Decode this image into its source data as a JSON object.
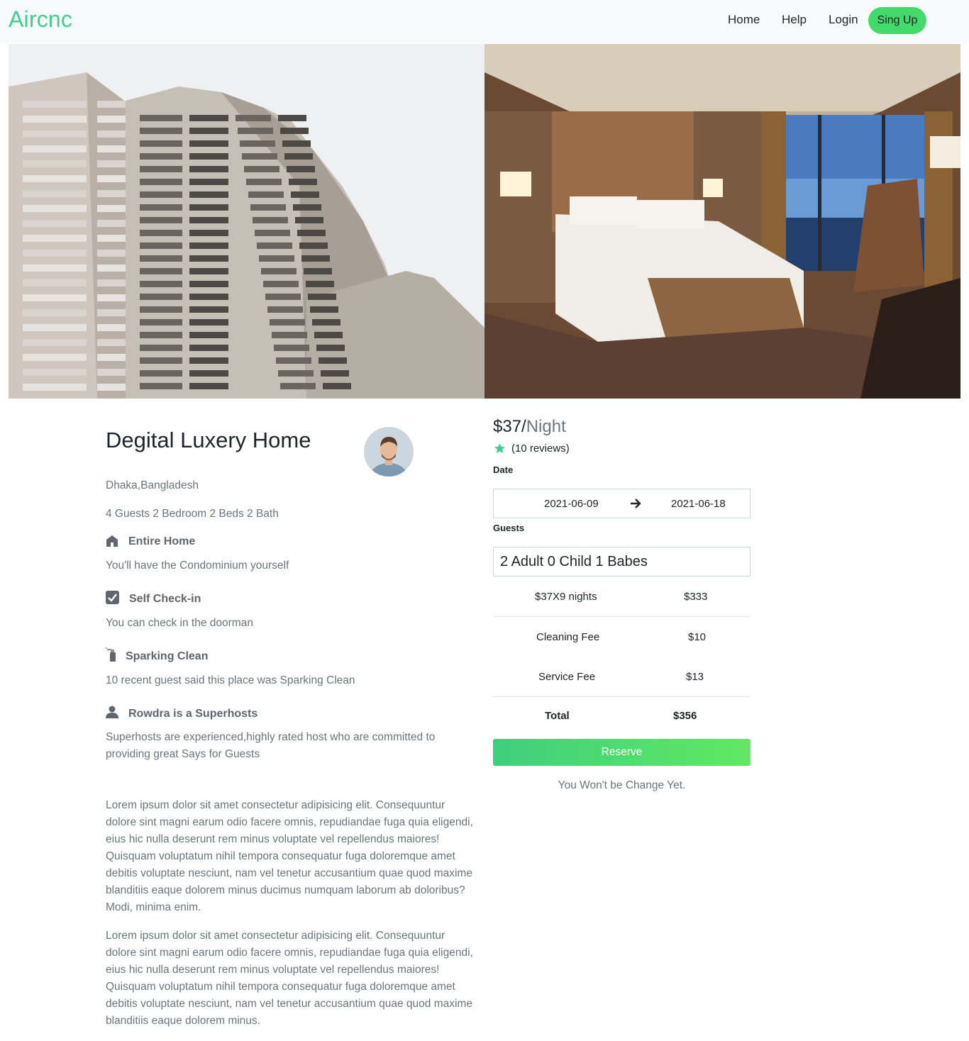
{
  "nav": {
    "brand": "Aircnc",
    "links": [
      "Home",
      "Help",
      "Login"
    ],
    "signup": "Sing Up",
    "brand_color": "#3ecf8e",
    "signup_color": "#44d96b"
  },
  "listing": {
    "title": "Degital Luxery Home",
    "location": "Dhaka,Bangladesh",
    "specs": "4 Guests 2 Bedroom 2 Beds 2 Bath",
    "features": [
      {
        "icon": "home-icon",
        "title": "Entire Home",
        "desc": "You'll have the Condominium yourself"
      },
      {
        "icon": "checkbox-icon",
        "title": "Self Check-in",
        "desc": "You can check in the doorman"
      },
      {
        "icon": "spray-bottle-icon",
        "title": "Sparking Clean",
        "desc": "10 recent guest said this place was Sparking Clean"
      },
      {
        "icon": "user-icon",
        "title": "Rowdra is a Superhosts",
        "desc": "Superhosts are experienced,highly rated host who are committed to providing great Says for Guests"
      }
    ],
    "paragraphs": [
      "Lorem ipsum dolor sit amet consectetur adipisicing elit. Consequuntur dolore sint magni earum odio facere omnis, repudiandae fuga quia eligendi, eius hic nulla deserunt rem minus voluptate vel repellendus maiores! Quisquam voluptatum nihil tempora consequatur fuga doloremque amet debitis voluptate nesciunt, nam vel tenetur accusantium quae quod maxime blanditiis eaque dolorem minus ducimus numquam laborum ab doloribus? Modi, minima enim.",
      "Lorem ipsum dolor sit amet consectetur adipisicing elit. Consequuntur dolore sint magni earum odio facere omnis, repudiandae fuga quia eligendi, eius hic nulla deserunt rem minus voluptate vel repellendus maiores! Quisquam voluptatum nihil tempora consequatur fuga doloremque amet debitis voluptate nesciunt, nam vel tenetur accusantium quae quod maxime blanditiis eaque dolorem minus."
    ]
  },
  "booking": {
    "price": "$37/",
    "per": "Night",
    "reviews": "(10 reviews)",
    "date_label": "Date",
    "date_from": "2021-06-09",
    "date_to": "2021-06-18",
    "guests_label": "Guests",
    "guests": "2 Adult 0 Child 1 Babes",
    "rows": [
      {
        "label": "$37X9 nights",
        "value": "$333"
      },
      {
        "label": "Cleaning Fee",
        "value": "$10"
      },
      {
        "label": "Service Fee",
        "value": "$13"
      }
    ],
    "total_label": "Total",
    "total_value": "$356",
    "reserve": "Reserve",
    "note": "You Won't be Change Yet.",
    "star_color": "#3ecf8e"
  }
}
